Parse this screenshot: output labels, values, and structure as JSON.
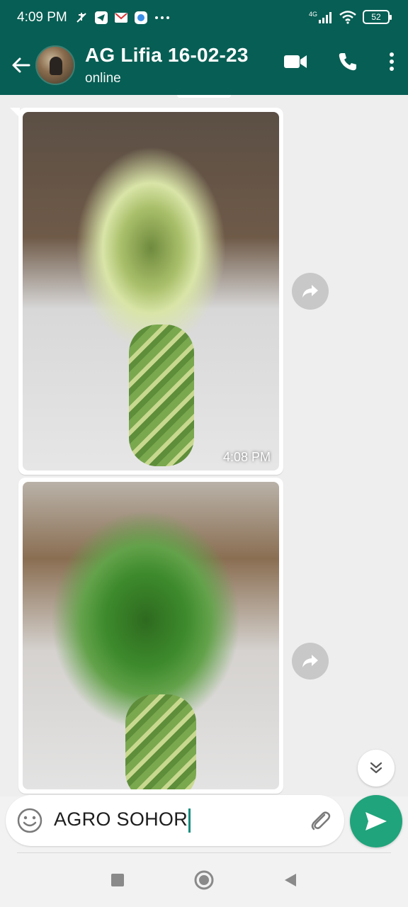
{
  "status_bar": {
    "time": "4:09 PM",
    "notification_icons": [
      "mute-icon",
      "telegram-icon",
      "gmail-icon",
      "messenger-icon",
      "more-dots-icon"
    ],
    "network": "4G",
    "battery": "52"
  },
  "header": {
    "contact_name": "AG Lifia 16-02-23",
    "status": "online",
    "colors": {
      "primary": "#075e54"
    }
  },
  "messages": [
    {
      "type": "image",
      "subject": "variegated lucky bamboo",
      "time": "4:08 PM"
    },
    {
      "type": "image",
      "subject": "green lucky bamboo",
      "time": ""
    }
  ],
  "composer": {
    "text": "AGRO SOHOR",
    "send_color": "#20a47b"
  }
}
